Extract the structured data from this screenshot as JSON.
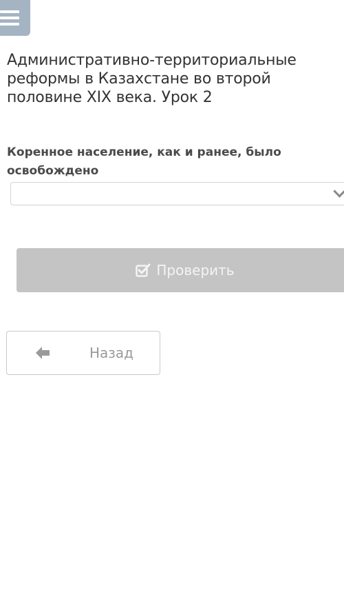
{
  "header": {
    "menu_icon": "hamburger-menu-icon",
    "title": "Административно-территориальные реформы в Казахстане во второй половине XIX века. Урок 2"
  },
  "question": {
    "text": "Коренное население, как и ранее, было освобождено",
    "dropdown_value": "",
    "dropdown_icon": "chevron-down-icon"
  },
  "actions": {
    "check_label": "Проверить",
    "check_icon": "check-square-icon",
    "back_label": "Назад",
    "back_icon": "arrow-left-icon"
  },
  "colors": {
    "menu_bg": "#a4b4c3",
    "check_bg": "#c4c4c4",
    "text": "#333333"
  }
}
